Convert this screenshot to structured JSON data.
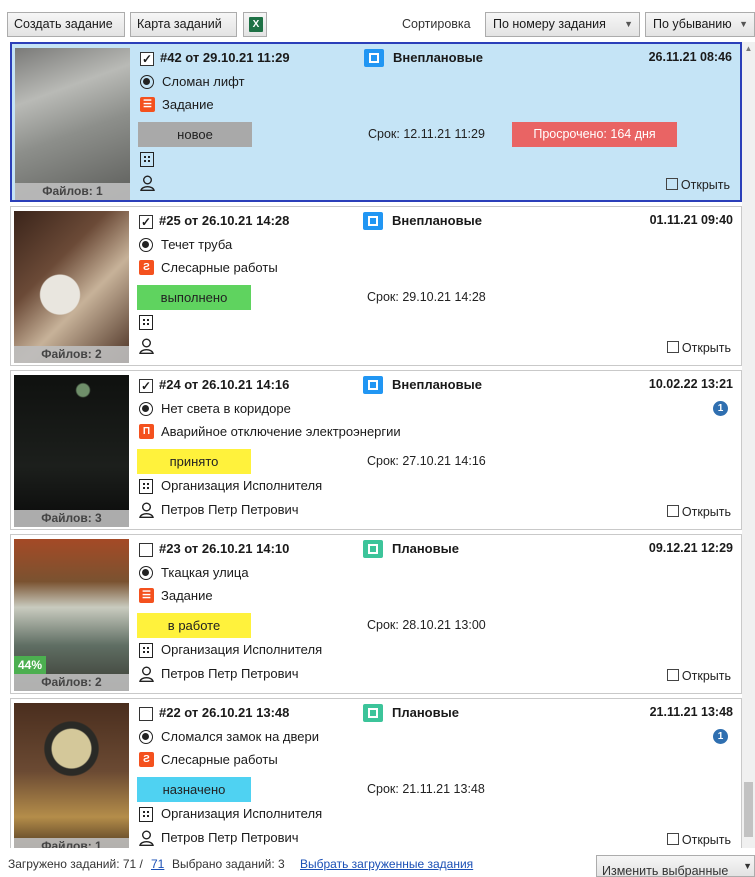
{
  "toolbar": {
    "create_label": "Создать задание",
    "map_label": "Карта заданий",
    "excel_icon": "excel-icon",
    "sort_label": "Сортировка",
    "sort_by": "По номеру задания",
    "sort_order": "По убыванию"
  },
  "tasks": [
    {
      "checked": "✓",
      "header": "#42  от  29.10.21 11:29",
      "category": "Внеплановые",
      "category_color": "#2196f3",
      "date": "26.11.21 08:46",
      "object": "Сломан лифт",
      "type": "Задание",
      "type_color": "#f4511e",
      "type_glyph": "☰",
      "status": "новое",
      "status_color": "#a9a9a9",
      "deadline": "Срок: 12.11.21 11:29",
      "overdue": "Просрочено: 164 дня",
      "organization": "",
      "executor": "",
      "badge": "",
      "files": "Файлов: 1",
      "open_label": "Открыть",
      "selected": true
    },
    {
      "checked": "✓",
      "header": "#25  от  26.10.21 14:28",
      "category": "Внеплановые",
      "category_color": "#2196f3",
      "date": "01.11.21 09:40",
      "object": "Течет труба",
      "type": "Слесарные работы",
      "type_color": "#f4511e",
      "type_glyph": "Ƨ",
      "status": "выполнено",
      "status_color": "#5fd35f",
      "deadline": "Срок: 29.10.21 14:28",
      "overdue": "",
      "organization": "",
      "executor": "",
      "badge": "",
      "files": "Файлов: 2",
      "open_label": "Открыть",
      "selected": false
    },
    {
      "checked": "✓",
      "header": "#24  от  26.10.21 14:16",
      "category": "Внеплановые",
      "category_color": "#2196f3",
      "date": "10.02.22 13:21",
      "object": "Нет света в коридоре",
      "type": "Аварийное отключение электроэнергии",
      "type_color": "#f4511e",
      "type_glyph": "Π",
      "status": "принято",
      "status_color": "#fff23c",
      "deadline": "Срок: 27.10.21 14:16",
      "overdue": "",
      "organization": "Организация Исполнителя",
      "executor": "Петров Петр Петрович",
      "badge": "1",
      "files": "Файлов: 3",
      "open_label": "Открыть",
      "selected": false
    },
    {
      "checked": "",
      "header": "#23  от  26.10.21 14:10",
      "category": "Плановые",
      "category_color": "#3cc49a",
      "date": "09.12.21 12:29",
      "object": "Ткацкая улица",
      "type": "Задание",
      "type_color": "#f4511e",
      "type_glyph": "☰",
      "status": "в работе",
      "status_color": "#fff23c",
      "deadline": "Срок: 28.10.21 13:00",
      "overdue": "",
      "organization": "Организация Исполнителя",
      "executor": "Петров Петр Петрович",
      "badge": "",
      "files": "Файлов: 2",
      "progress": "44%",
      "open_label": "Открыть",
      "selected": false
    },
    {
      "checked": "",
      "header": "#22  от  26.10.21 13:48",
      "category": "Плановые",
      "category_color": "#3cc49a",
      "date": "21.11.21 13:48",
      "object": "Сломался замок на двери",
      "type": "Слесарные работы",
      "type_color": "#f4511e",
      "type_glyph": "Ƨ",
      "status": "назначено",
      "status_color": "#4fd2f2",
      "deadline": "Срок: 21.11.21 13:48",
      "overdue": "",
      "organization": "Организация Исполнителя",
      "executor": "Петров Петр Петрович",
      "badge": "1",
      "files": "Файлов: 1",
      "open_label": "Открыть",
      "selected": false
    }
  ],
  "footer": {
    "loaded_label": "Загружено заданий: 71 /",
    "loaded_total": "71",
    "selected_label": "Выбрано заданий: 3",
    "select_loaded_link": "Выбрать загруженные задания",
    "apply_label": "Изменить выбранные"
  }
}
